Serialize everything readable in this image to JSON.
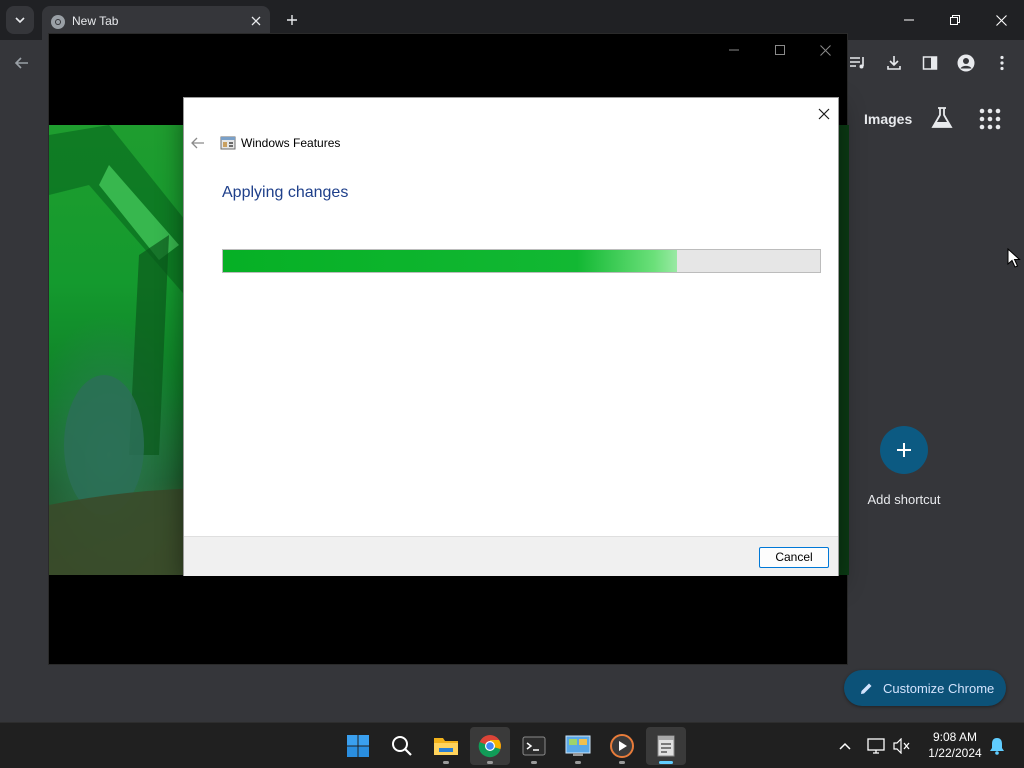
{
  "browser": {
    "tab_title": "New Tab",
    "toolbar_icons": [
      "back-arrow-icon",
      "media-control-icon",
      "download-icon",
      "side-panel-icon",
      "profile-icon",
      "more-menu-icon"
    ],
    "ntp": {
      "images_link": "Images",
      "shortcut_label": "Add shortcut",
      "customize_label": "Customize Chrome"
    }
  },
  "media_player": {
    "background_color": "#000000"
  },
  "dialog": {
    "title": "Windows Features",
    "heading": "Applying changes",
    "progress_fraction": 0.76,
    "cancel_label": "Cancel",
    "accent_color": "#06b025",
    "heading_color": "#1e3f8a"
  },
  "taskbar": {
    "apps": [
      "start-icon",
      "search-icon",
      "file-explorer-icon",
      "chrome-icon",
      "terminal-icon",
      "control-panel-icon",
      "media-player-icon",
      "windows-features-icon"
    ],
    "time": "9:08 AM",
    "date": "1/22/2024"
  }
}
